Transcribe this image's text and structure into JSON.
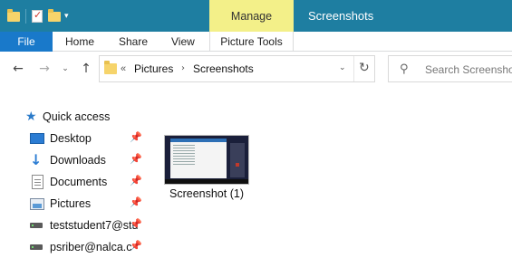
{
  "titlebar": {
    "title": "Screenshots",
    "contextual_tab": "Manage",
    "qat_dropdown_icon": "chevron-down-icon"
  },
  "ribbon": {
    "tabs": [
      {
        "label": "File"
      },
      {
        "label": "Home"
      },
      {
        "label": "Share"
      },
      {
        "label": "View"
      },
      {
        "label": "Picture Tools"
      }
    ]
  },
  "address": {
    "overflow": "«",
    "path": [
      "Pictures",
      "Screenshots"
    ]
  },
  "search": {
    "placeholder": "Search Screenshots"
  },
  "navpane": {
    "quick_access": "Quick access",
    "items": [
      {
        "label": "Desktop",
        "icon": "desktop-icon",
        "pinned": true
      },
      {
        "label": "Downloads",
        "icon": "download-icon",
        "pinned": true
      },
      {
        "label": "Documents",
        "icon": "documents-icon",
        "pinned": true
      },
      {
        "label": "Pictures",
        "icon": "pictures-icon",
        "pinned": true
      },
      {
        "label": "teststudent7@stu",
        "icon": "network-drive-icon",
        "pinned": true
      },
      {
        "label": "psriber@nalca.c",
        "icon": "network-drive-icon",
        "pinned": true
      }
    ]
  },
  "files": [
    {
      "name": "Screenshot (1)"
    }
  ],
  "colors": {
    "titlebar": "#1e7ea1",
    "manage_tab": "#f3f089",
    "file_tab": "#1979ca"
  }
}
